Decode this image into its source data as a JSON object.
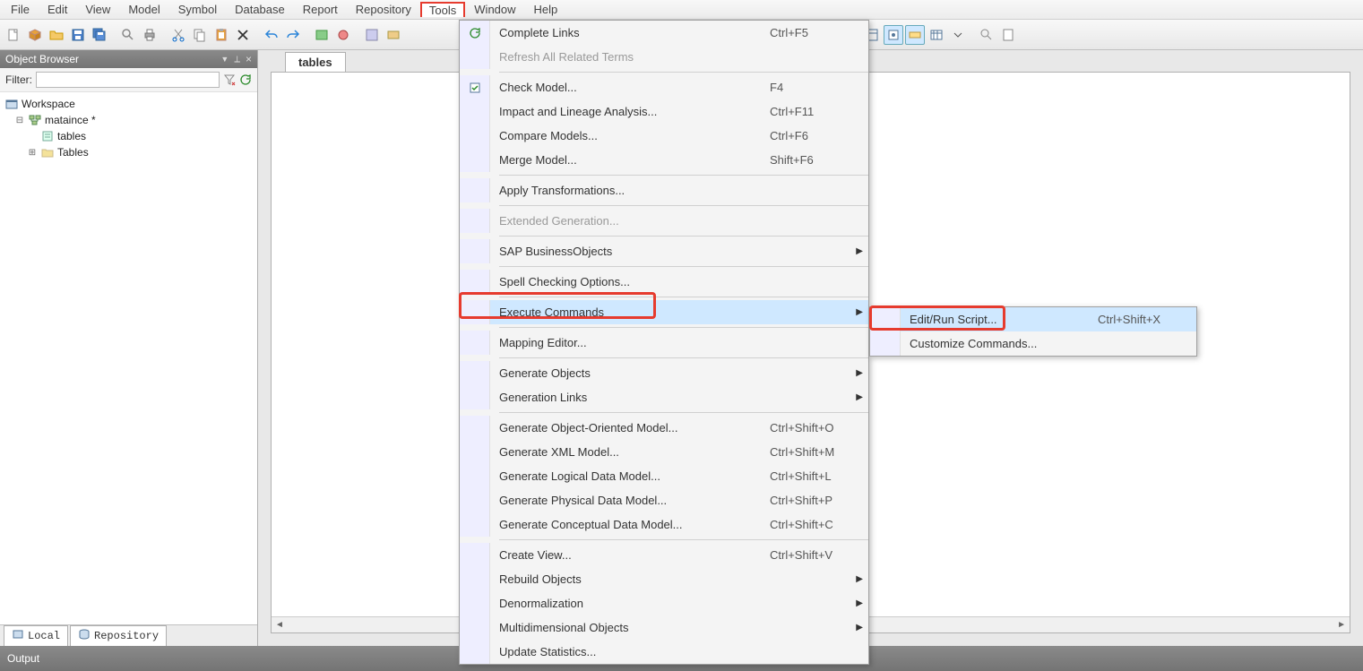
{
  "menubar": [
    "File",
    "Edit",
    "View",
    "Model",
    "Symbol",
    "Database",
    "Report",
    "Repository",
    "Tools",
    "Window",
    "Help"
  ],
  "menubar_active_index": 8,
  "left_panel": {
    "title": "Object Browser",
    "filter_label": "Filter:",
    "filter_value": "",
    "tree": {
      "root": "Workspace",
      "n1": "mataince *",
      "n2": "tables",
      "n3": "Tables"
    },
    "bottom_tabs": [
      "Local",
      "Repository"
    ]
  },
  "doc_tab": "tables",
  "output_title": "Output",
  "tools_menu": [
    {
      "icon": "refresh",
      "label": "Complete Links",
      "shortcut": "Ctrl+F5"
    },
    {
      "label": "Refresh All Related Terms",
      "disabled": true
    },
    {
      "sep": true
    },
    {
      "icon": "check",
      "label": "Check Model...",
      "shortcut": "F4"
    },
    {
      "label": "Impact and Lineage Analysis...",
      "shortcut": "Ctrl+F11"
    },
    {
      "label": "Compare Models...",
      "shortcut": "Ctrl+F6"
    },
    {
      "label": "Merge Model...",
      "shortcut": "Shift+F6"
    },
    {
      "sep": true
    },
    {
      "label": "Apply Transformations..."
    },
    {
      "sep": true
    },
    {
      "label": "Extended Generation...",
      "disabled": true
    },
    {
      "sep": true
    },
    {
      "label": "SAP BusinessObjects",
      "submenu": true
    },
    {
      "sep": true
    },
    {
      "label": "Spell Checking Options..."
    },
    {
      "sep": true
    },
    {
      "label": "Execute Commands",
      "submenu": true,
      "hover": true,
      "redbox": 1
    },
    {
      "sep": true
    },
    {
      "label": "Mapping Editor..."
    },
    {
      "sep": true
    },
    {
      "label": "Generate Objects",
      "submenu": true
    },
    {
      "label": "Generation Links",
      "submenu": true
    },
    {
      "sep": true
    },
    {
      "label": "Generate Object-Oriented Model...",
      "shortcut": "Ctrl+Shift+O"
    },
    {
      "label": "Generate XML Model...",
      "shortcut": "Ctrl+Shift+M"
    },
    {
      "label": "Generate Logical Data Model...",
      "shortcut": "Ctrl+Shift+L"
    },
    {
      "label": "Generate Physical Data Model...",
      "shortcut": "Ctrl+Shift+P"
    },
    {
      "label": "Generate Conceptual Data Model...",
      "shortcut": "Ctrl+Shift+C"
    },
    {
      "sep": true
    },
    {
      "label": "Create View...",
      "shortcut": "Ctrl+Shift+V"
    },
    {
      "label": "Rebuild Objects",
      "submenu": true
    },
    {
      "label": "Denormalization",
      "submenu": true
    },
    {
      "label": "Multidimensional Objects",
      "submenu": true
    },
    {
      "label": "Update Statistics..."
    }
  ],
  "submenu": [
    {
      "label": "Edit/Run Script...",
      "shortcut": "Ctrl+Shift+X",
      "hover": true,
      "redbox": 2
    },
    {
      "label": "Customize Commands..."
    }
  ]
}
